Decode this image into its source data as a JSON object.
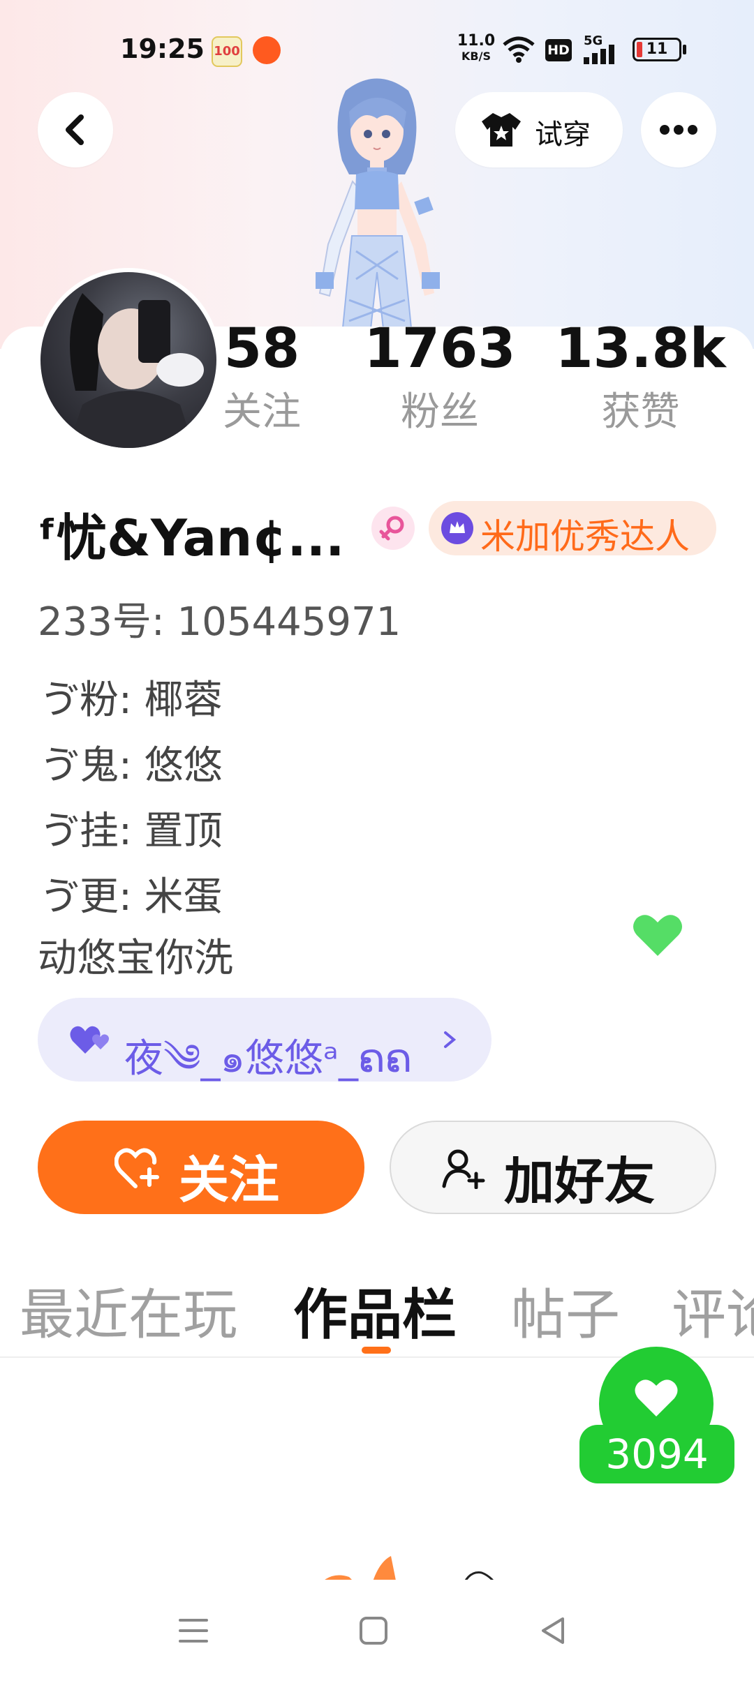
{
  "status_bar": {
    "time": "19:25",
    "net_speed_value": "11.0",
    "net_speed_unit": "KB/S",
    "hd": "HD",
    "signal": "5G",
    "battery": "11"
  },
  "header": {
    "try_on_label": "试穿"
  },
  "stats": [
    {
      "value": "58",
      "label": "关注"
    },
    {
      "value": "1763",
      "label": "粉丝"
    },
    {
      "value": "13.8k",
      "label": "获赞"
    }
  ],
  "profile": {
    "name": "ᶠ忧&Yan¢...",
    "badge": "米加优秀达人",
    "id_line": "233号: 105445971",
    "bio_lines": [
      "ゔ粉: 椰蓉",
      "ゔ鬼: 悠悠",
      "ゔ挂: 置顶",
      "ゔ更: 米蛋",
      "动悠宝你洗"
    ],
    "relation_tag": "夜༄_๑悠悠ᵃ_ຄຄ"
  },
  "actions": {
    "follow": "关注",
    "add_friend": "加好友"
  },
  "tabs": [
    "最近在玩",
    "作品栏",
    "帖子",
    "评论"
  ],
  "like_count": "3094",
  "colors": {
    "accent_orange": "#ff7019",
    "like_green": "#22cc33",
    "heart_green": "#55dd66",
    "tag_purple": "#6c5ce7"
  }
}
